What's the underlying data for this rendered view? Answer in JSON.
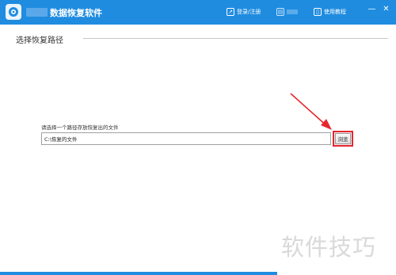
{
  "titlebar": {
    "app_title": "数据恢复软件",
    "buttons": [
      {
        "label": "登录/注册",
        "icon": "login-icon"
      },
      {
        "label": "",
        "icon": "blurred-button-icon"
      },
      {
        "label": "使用教程",
        "icon": "book-icon"
      }
    ],
    "window_controls": {
      "minimize": "—",
      "close": "✕"
    }
  },
  "section": {
    "title": "选择恢复路径"
  },
  "path": {
    "label": "请选择一个路径存放恢复出的文件",
    "value": "C:\\恢复的文件"
  },
  "browse": {
    "label": "浏览"
  },
  "watermark": {
    "text": "软件技巧"
  },
  "colors": {
    "accent": "#1f8ce0",
    "highlight": "#e8262d"
  }
}
